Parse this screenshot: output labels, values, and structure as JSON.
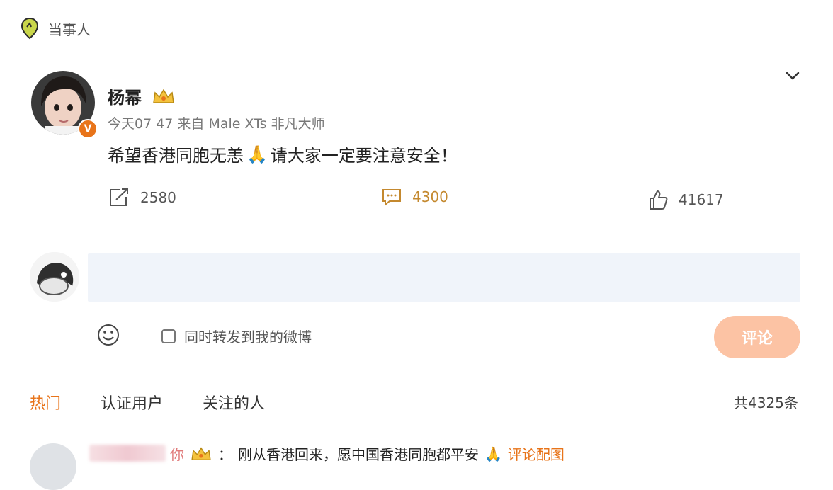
{
  "tag": {
    "icon": "location-pin-icon",
    "label": "当事人"
  },
  "post": {
    "author": "杨幂",
    "badge_icon": "crown-badge-icon",
    "verified_mark": "V",
    "meta": "今天07 47  来自 Male XTs 非凡大师",
    "text_before": "希望香港同胞无恙",
    "text_emoji": "🙏",
    "text_after": " 请大家一定要注意安全！",
    "reposts": "2580",
    "comments": "4300",
    "likes": "41617"
  },
  "composer": {
    "input_value": "",
    "emoji_icon": "smiley-icon",
    "forward_label": "同时转发到我的微博",
    "submit_label": "评论"
  },
  "tabs": [
    "热门",
    "认证用户",
    "关注的人"
  ],
  "total": "共4325条",
  "first_comment": {
    "name_visible": "你",
    "separator": "：",
    "text": "刚从香港回来，愿中国香港同胞都平安",
    "emoji": "🙏",
    "link": "评论配图"
  },
  "colors": {
    "accent": "#e8741a",
    "input_bg": "#f0f4fa",
    "submit_bg": "#fcc3a4",
    "comment_count": "#c4892f"
  }
}
